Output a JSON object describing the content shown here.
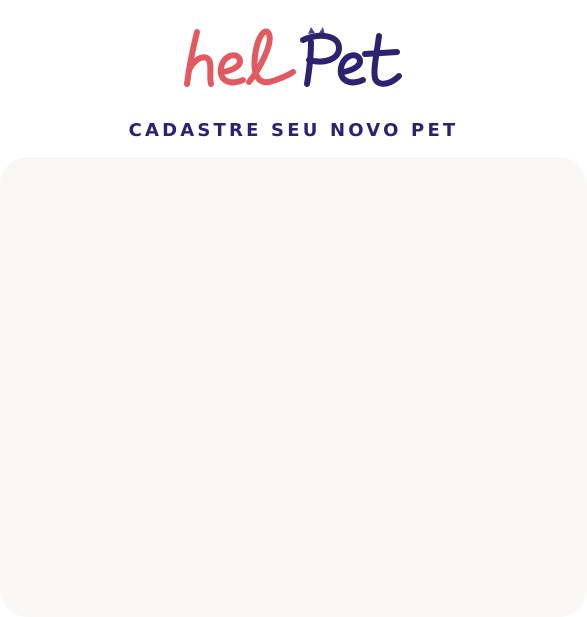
{
  "brand": {
    "logo_text": "helPet",
    "logo_part_1": "hel",
    "logo_part_2": "Pet",
    "logo_color_primary": "#e05a60",
    "logo_color_secondary": "#2b2270"
  },
  "header": {
    "subtitle": "CADASTRE SEU NOVO PET"
  },
  "colors": {
    "card_background": "#f9f8f6",
    "page_background": "#ffffff",
    "heading": "#2b2270"
  }
}
